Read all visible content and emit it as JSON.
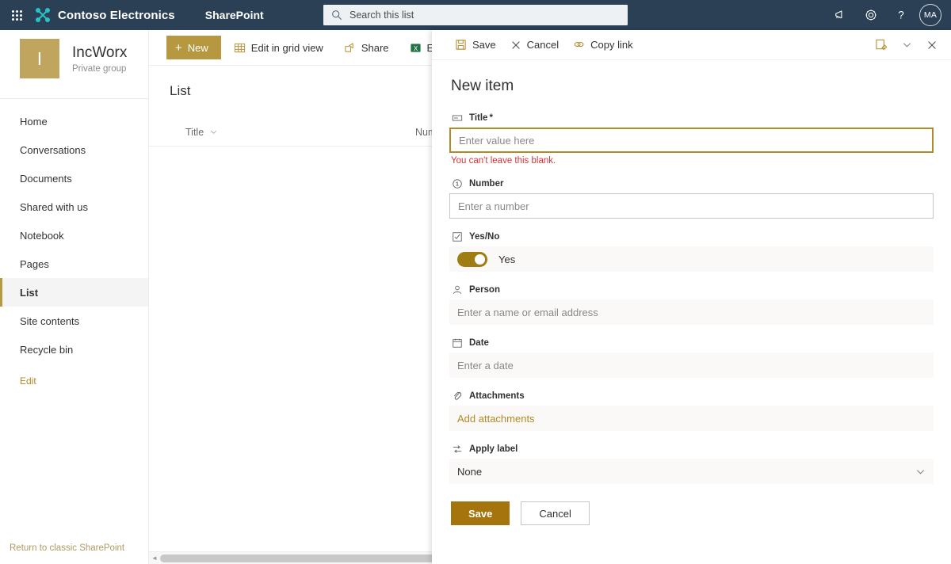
{
  "suite": {
    "waffle_name": "app-launcher",
    "brand": "Contoso Electronics",
    "app": "SharePoint",
    "search_placeholder": "Search this list",
    "search_value": "",
    "icons": [
      "megaphone-icon",
      "gear-icon",
      "help-icon"
    ],
    "avatar_initials": "MA"
  },
  "site": {
    "logo_letter": "I",
    "title": "IncWorx",
    "subtitle": "Private group",
    "nav": [
      {
        "label": "Home",
        "selected": false
      },
      {
        "label": "Conversations",
        "selected": false
      },
      {
        "label": "Documents",
        "selected": false
      },
      {
        "label": "Shared with us",
        "selected": false
      },
      {
        "label": "Notebook",
        "selected": false
      },
      {
        "label": "Pages",
        "selected": false
      },
      {
        "label": "List",
        "selected": true
      },
      {
        "label": "Site contents",
        "selected": false
      },
      {
        "label": "Recycle bin",
        "selected": false
      }
    ],
    "edit_label": "Edit",
    "classic_link": "Return to classic SharePoint"
  },
  "commandbar": {
    "new_label": "New",
    "grid_label": "Edit in grid view",
    "share_label": "Share",
    "export_label": "Export to E"
  },
  "list": {
    "title": "List",
    "columns": [
      {
        "label": "Title"
      },
      {
        "label": "Numbe"
      }
    ],
    "rows": []
  },
  "panel": {
    "commands": {
      "save": "Save",
      "cancel": "Cancel",
      "copy_link": "Copy link"
    },
    "right_icons": [
      "edit-form-icon",
      "chevron-down-icon",
      "close-icon"
    ],
    "heading": "New item",
    "fields": [
      {
        "key": "title",
        "label": "Title",
        "required": true,
        "icon": "textbox-icon",
        "type": "text",
        "placeholder": "Enter value here",
        "value": "",
        "focused": true,
        "error": "You can't leave this blank."
      },
      {
        "key": "number",
        "label": "Number",
        "required": false,
        "icon": "number-icon",
        "type": "text",
        "placeholder": "Enter a number",
        "value": "",
        "focused": false,
        "error": ""
      },
      {
        "key": "yesno",
        "label": "Yes/No",
        "required": false,
        "icon": "checkbox-icon",
        "type": "toggle",
        "toggle_on": true,
        "toggle_label": "Yes"
      },
      {
        "key": "person",
        "label": "Person",
        "required": false,
        "icon": "person-icon",
        "type": "flat",
        "placeholder": "Enter a name or email address"
      },
      {
        "key": "date",
        "label": "Date",
        "required": false,
        "icon": "calendar-icon",
        "type": "flat",
        "placeholder": "Enter a date"
      },
      {
        "key": "attachments",
        "label": "Attachments",
        "required": false,
        "icon": "paperclip-icon",
        "type": "link",
        "link_label": "Add attachments"
      },
      {
        "key": "apply_label",
        "label": "Apply label",
        "required": false,
        "icon": "label-icon",
        "type": "select",
        "selected": "None"
      }
    ],
    "actions": {
      "save": "Save",
      "cancel": "Cancel"
    }
  },
  "colors": {
    "suite_bar": "#2b4055",
    "brand_accent": "#29c3c3",
    "site_logo": "#bfa55e",
    "accent_gold": "#b5983f",
    "save_gold": "#a6740c",
    "toggle_on": "#a07d12",
    "link_gold": "#b08a26",
    "error_red": "#d13438",
    "excel_green": "#217346"
  }
}
